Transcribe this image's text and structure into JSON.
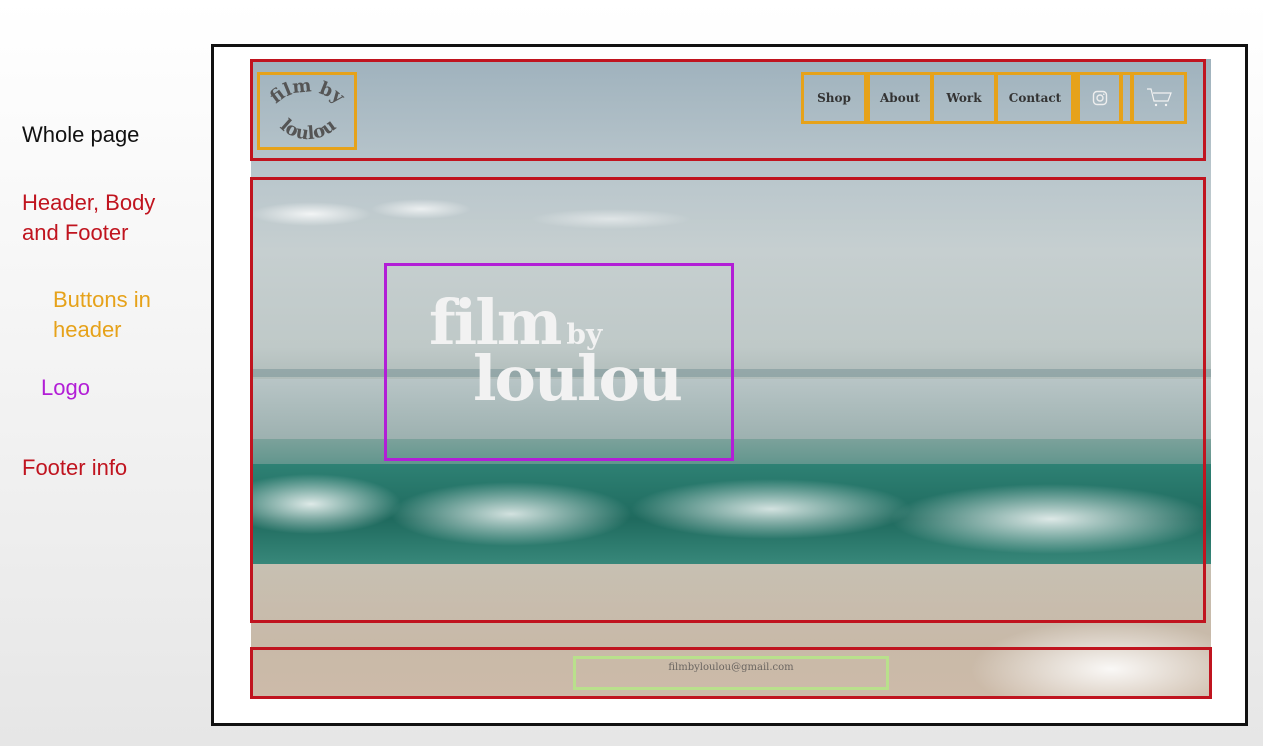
{
  "legend": {
    "whole_page": "Whole page",
    "header_body_footer": "Header, Body and Footer",
    "buttons_in_header": "Buttons in header",
    "logo": "Logo",
    "footer_info": "Footer info"
  },
  "colors": {
    "whole_page": "#111111",
    "sections": "#c0141f",
    "buttons": "#e6a21a",
    "logo": "#b21ed6",
    "footer_info": "#b9e08c"
  },
  "header": {
    "logo_top": "film by",
    "logo_bottom": "loulou",
    "nav": [
      "Shop",
      "About",
      "Work",
      "Contact"
    ],
    "icons": [
      "instagram-icon",
      "cart-icon"
    ]
  },
  "hero": {
    "logo_film": "film",
    "logo_by": "by",
    "logo_loulou": "loulou"
  },
  "footer": {
    "email": "filmbyloulou@gmail.com"
  }
}
